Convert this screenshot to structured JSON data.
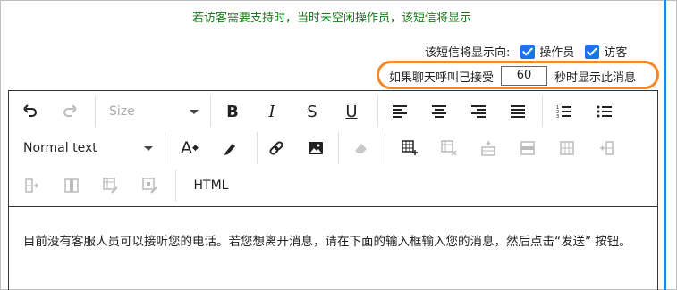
{
  "notice": {
    "text": "若访客需要支持时，当时未空闲操作员，该短信将显示"
  },
  "display_to": {
    "label": "该短信将显示向:",
    "options": [
      {
        "label": "操作员",
        "checked": true
      },
      {
        "label": "访客",
        "checked": true
      }
    ]
  },
  "accept": {
    "prefix": "如果聊天呼叫已接受",
    "seconds": "60",
    "suffix": "秒时显示此消息",
    "highlight_color": "#f0892a"
  },
  "toolbar": {
    "size_placeholder": "Size",
    "format_value": "Normal text",
    "html_label": "HTML",
    "font_color_label": "A",
    "icons": [
      "undo-icon",
      "redo-icon",
      "bold-icon",
      "italic-icon",
      "strikethrough-icon",
      "underline-icon",
      "align-left-icon",
      "align-center-icon",
      "align-right-icon",
      "align-justify-icon",
      "ordered-list-icon",
      "unordered-list-icon",
      "font-color-icon",
      "highlighter-icon",
      "link-icon",
      "image-icon",
      "eraser-icon",
      "insert-table-icon",
      "delete-table-icon",
      "insert-row-above-icon",
      "delete-row-icon",
      "merge-cells-icon",
      "insert-column-icon",
      "insert-column-left-icon",
      "delete-column-icon",
      "table-properties-icon",
      "cell-properties-icon"
    ]
  },
  "editor": {
    "content": "目前没有客服人员可以接听您的电话。若您想离开消息，请在下面的输入框输入您的消息，然后点击“发送” 按钮。"
  },
  "colors": {
    "notice": "#1a7a1a",
    "checkbox": "#1a73e8",
    "scrollbar": "#2a86d8"
  }
}
